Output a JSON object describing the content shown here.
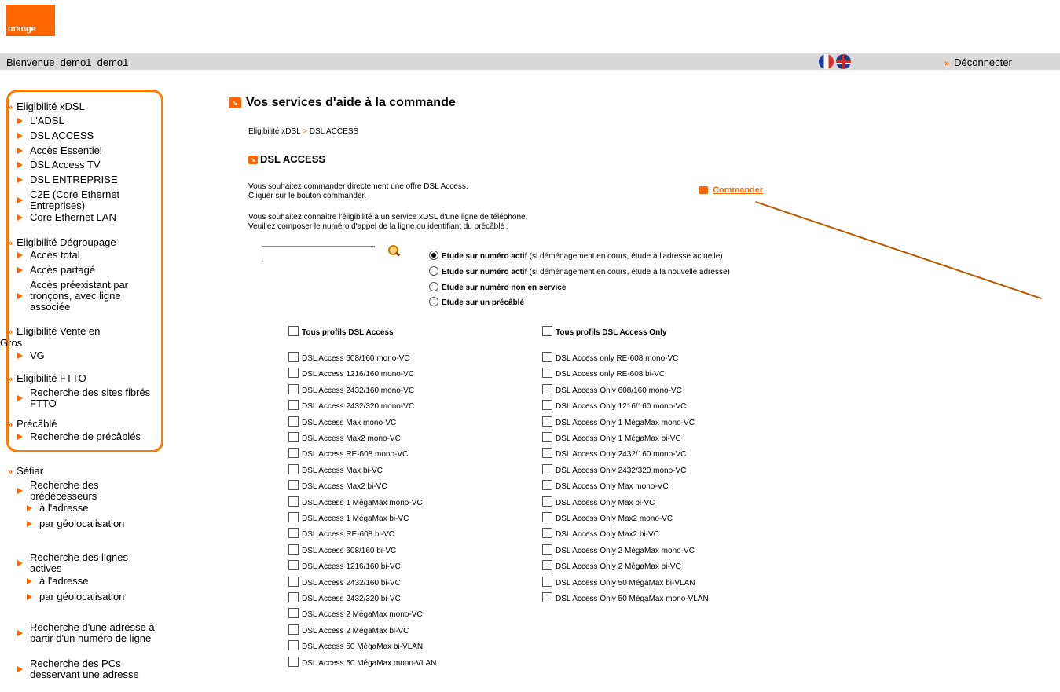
{
  "brand": {
    "logo_text": "orange",
    "color": "#ff6600"
  },
  "topbar": {
    "welcome": "Bienvenue  demo1  demo1",
    "logout": "Déconnecter"
  },
  "nav": {
    "groups": [
      {
        "title": "Eligibilité xDSL",
        "items": [
          "L'ADSL",
          "DSL ACCESS",
          "Accès Essentiel",
          "DSL Access TV",
          "DSL ENTREPRISE",
          "C2E (Core Ethernet Entreprises)",
          "Core Ethernet LAN"
        ]
      },
      {
        "title": "Eligibilité Dégroupage",
        "items": [
          "Accès total",
          "Accès partagé",
          "Accès préexistant par tronçons, avec ligne associée"
        ]
      },
      {
        "title": "Eligibilité Vente en Gros",
        "items": [
          "VG"
        ]
      },
      {
        "title": "Eligibilité FTTO",
        "items": [
          "Recherche des sites fibrés FTTO"
        ]
      },
      {
        "title": "Précâblé",
        "items": [
          "Recherche de précâblés"
        ]
      },
      {
        "title": "Sétiar",
        "items": [
          "Recherche des prédécesseurs",
          "à l'adresse",
          "par géolocalisation",
          "Recherche des lignes actives",
          "à l'adresse",
          "par géolocalisation",
          "Recherche d'une adresse à partir d'un numéro de ligne",
          "Recherche des PCs desservant une adresse"
        ]
      }
    ]
  },
  "main": {
    "title": "Vos services d'aide à la commande",
    "breadcrumb": {
      "part1": "Eligibilité xDSL",
      "sep": ">",
      "part2": "DSL ACCESS"
    },
    "section_title": "DSL ACCESS",
    "intro1": "Vous souhaitez commander directement une offre DSL Access.",
    "intro2": "Cliquer sur le bouton commander.",
    "commander": "Commander",
    "intro3": "Vous souhaitez connaître l'éligibilité à un service xDSL d'une ligne de téléphone.",
    "intro4": "Veuillez composer le numéro d'appel de la ligne ou identifiant du précâblé :",
    "input_value": "",
    "radios": [
      {
        "bold": "Etude sur numéro actif",
        "rest": " (si déménagement en cours, étude à l'adresse actuelle)",
        "checked": true
      },
      {
        "bold": "Etude sur numéro actif",
        "rest": " (si déménagement en cours, étude à la nouvelle adresse)",
        "checked": false
      },
      {
        "bold": "Etude sur numéro non en service",
        "rest": "",
        "checked": false
      },
      {
        "bold": "Etude sur un précâblé",
        "rest": "",
        "checked": false
      }
    ],
    "col1_header": "Tous profils DSL Access",
    "col2_header": "Tous profils DSL Access Only",
    "col1": [
      "DSL Access 608/160 mono-VC",
      "DSL Access 1216/160 mono-VC",
      "DSL Access 2432/160 mono-VC",
      "DSL Access 2432/320 mono-VC",
      "DSL Access Max mono-VC",
      "DSL Access Max2 mono-VC",
      "DSL Access RE-608 mono-VC",
      "DSL Access Max bi-VC",
      "DSL Access Max2 bi-VC",
      "DSL Access 1 MégaMax mono-VC",
      "DSL Access 1 MégaMax bi-VC",
      "DSL Access RE-608 bi-VC",
      "DSL Access 608/160 bi-VC",
      "DSL Access 1216/160 bi-VC",
      "DSL Access 2432/160 bi-VC",
      "DSL Access 2432/320 bi-VC",
      "DSL Access 2 MégaMax mono-VC",
      "DSL Access 2 MégaMax bi-VC",
      "DSL Access 50 MégaMax bi-VLAN",
      "DSL Access 50 MégaMax mono-VLAN"
    ],
    "col2": [
      "DSL Access only RE-608 mono-VC",
      "DSL Access only RE-608 bi-VC",
      "DSL Access Only 608/160 mono-VC",
      "DSL Access Only 1216/160 mono-VC",
      "DSL Access Only 1 MégaMax mono-VC",
      "DSL Access Only 1 MégaMax bi-VC",
      "DSL Access Only 2432/160 mono-VC",
      "DSL Access Only 2432/320 mono-VC",
      "DSL Access Only Max mono-VC",
      "DSL Access Only Max bi-VC",
      "DSL Access Only Max2 mono-VC",
      "DSL Access Only Max2 bi-VC",
      "DSL Access Only 2 MégaMax mono-VC",
      "DSL Access Only 2 MégaMax bi-VC",
      "DSL Access Only 50 MégaMax bi-VLAN",
      "DSL Access Only 50 MégaMax mono-VLAN"
    ]
  }
}
